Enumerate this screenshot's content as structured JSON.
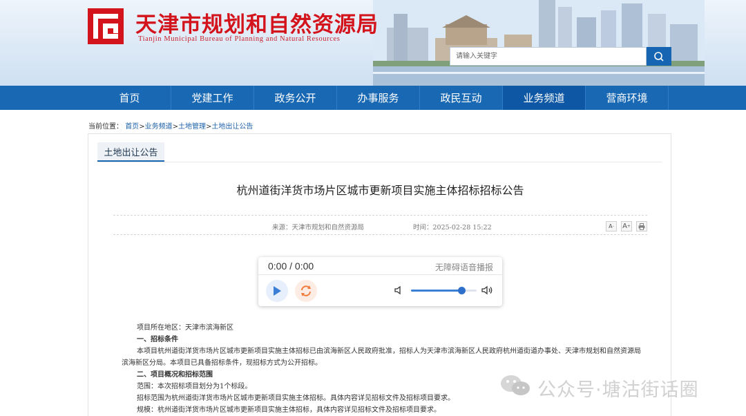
{
  "header": {
    "title": "天津市规划和自然资源局",
    "subtitle": "Tianjin Municipal Bureau of Planning and Natural Resources",
    "search_placeholder": "请输入关键字"
  },
  "nav": {
    "items": [
      {
        "label": "首页",
        "active": false
      },
      {
        "label": "党建工作",
        "active": false
      },
      {
        "label": "政务公开",
        "active": false
      },
      {
        "label": "办事服务",
        "active": false
      },
      {
        "label": "政民互动",
        "active": false
      },
      {
        "label": "业务频道",
        "active": true
      },
      {
        "label": "营商环境",
        "active": false
      }
    ]
  },
  "breadcrumb": {
    "prefix": "当前位置：",
    "items": [
      "首页",
      "业务频道",
      "土地管理",
      "土地出让公告"
    ],
    "separator": ">"
  },
  "section_tab": "土地出让公告",
  "article": {
    "title": "杭州道街洋货市场片区城市更新项目实施主体招标招标公告",
    "source": "来源：天津市规划和自然资源局",
    "time": "时间：2025-02-28 15:22",
    "tools": {
      "font_smaller": "A",
      "font_larger": "A",
      "print": "print-icon"
    }
  },
  "player": {
    "time": "0:00 / 0:00",
    "label": "无障碍语音播报",
    "volume": 0.77
  },
  "body": [
    {
      "text": "项目所在地区：天津市滨海新区",
      "heading": false
    },
    {
      "text": "一、招标条件",
      "heading": true
    },
    {
      "text": "本项目杭州道街洋货市场片区城市更新项目实施主体招标已由滨海新区人民政府批准，招标人为天津市滨海新区人民政府杭州道街道办事处、天津市规划和自然资源局滨海新区分局。本项目已具备招标条件，现招标方式为公开招标。",
      "heading": false
    },
    {
      "text": "二、项目概况和招标范围",
      "heading": true
    },
    {
      "text": "范围：本次招标项目划分为1个标段。",
      "heading": false
    },
    {
      "text": "招标范围为杭州道街洋货市场片区城市更新项目实施主体招标。具体内容详见招标文件及招标项目要求。",
      "heading": false
    },
    {
      "text": "规模：杭州道街洋货市场片区城市更新项目实施主体招标，具体内容详见招标文件及招标项目要求。",
      "heading": false
    }
  ],
  "watermark": "公众号·塘沽街话圈",
  "colors": {
    "nav": "#1968b3",
    "nav_active": "#0d57a4",
    "title_red": "#d4141c",
    "link": "#1a5fa8"
  }
}
